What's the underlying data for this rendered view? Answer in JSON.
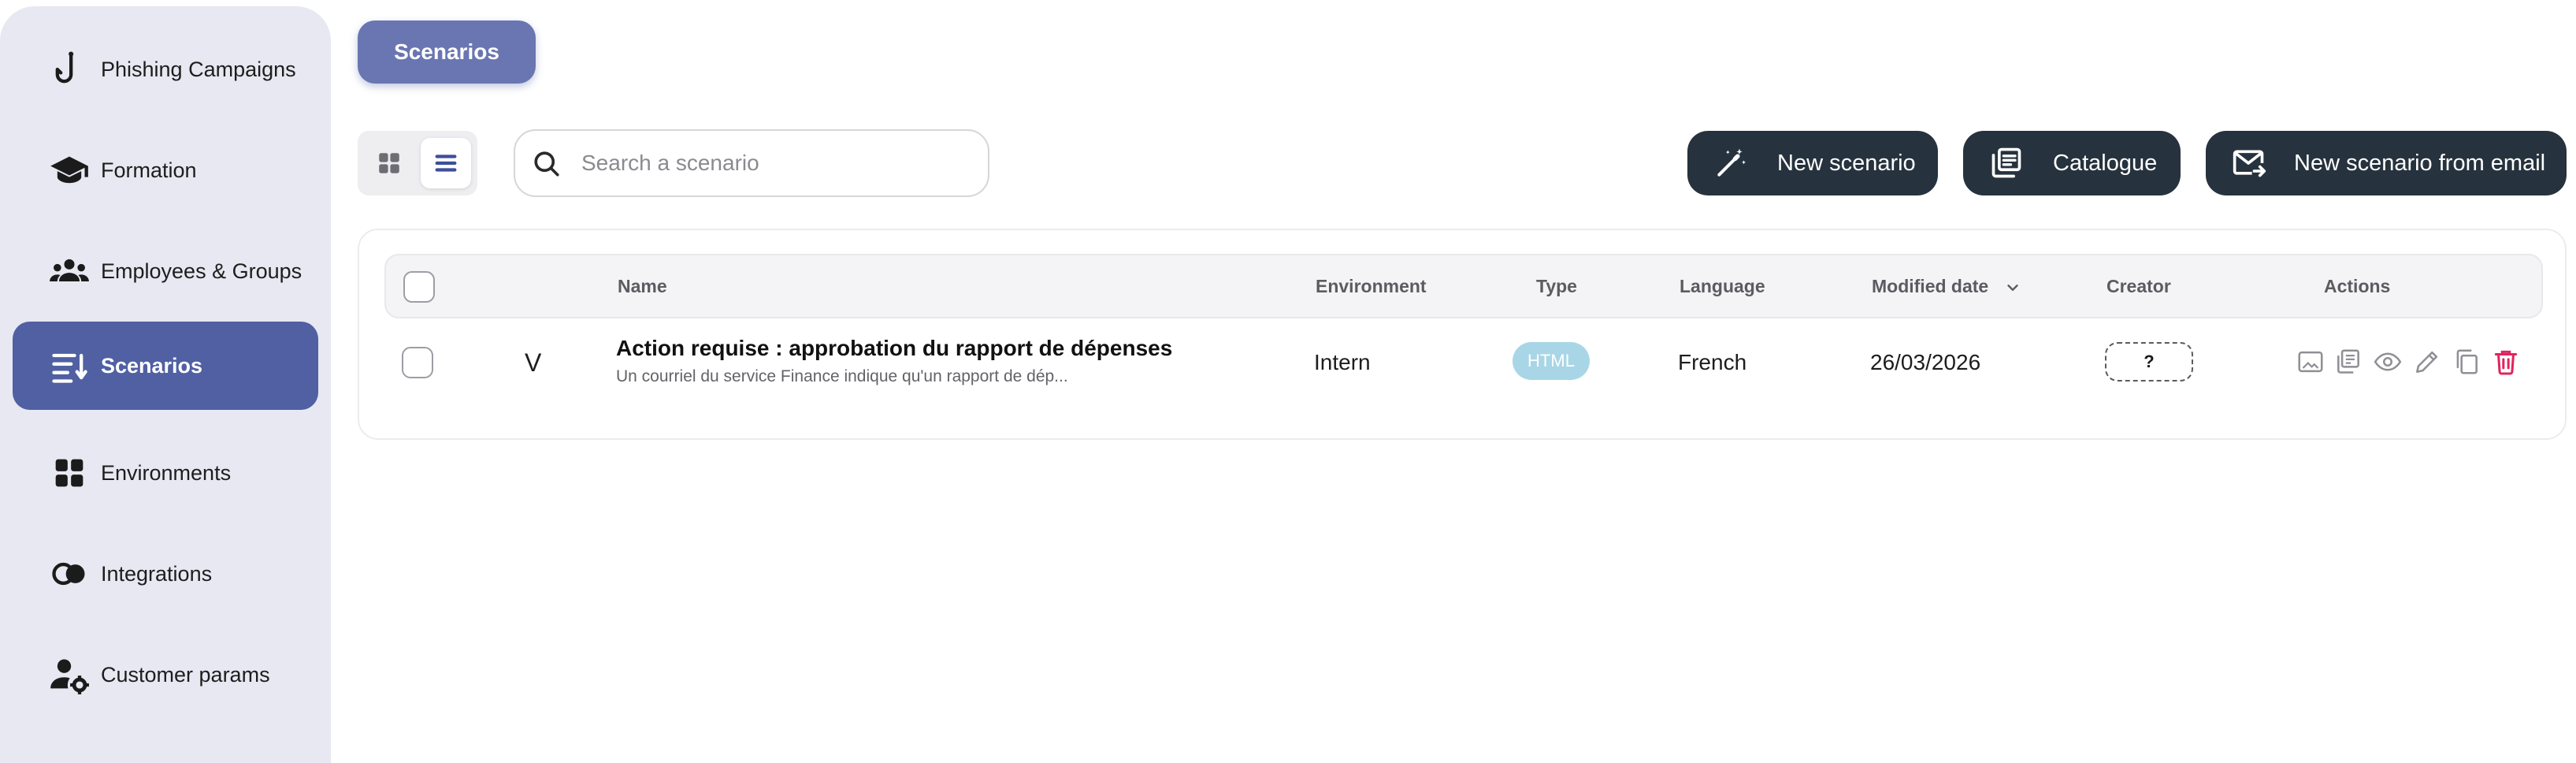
{
  "sidebar": {
    "items": [
      {
        "label": "Phishing Campaigns",
        "icon": "fishing-hook-icon",
        "active": false
      },
      {
        "label": "Formation",
        "icon": "graduation-cap-icon",
        "active": false
      },
      {
        "label": "Employees & Groups",
        "icon": "people-group-icon",
        "active": false
      },
      {
        "label": "Scenarios",
        "icon": "list-icon",
        "active": true
      },
      {
        "label": "Environments",
        "icon": "grid-icon",
        "active": false
      },
      {
        "label": "Integrations",
        "icon": "integrations-icon",
        "active": false
      },
      {
        "label": "Customer params",
        "icon": "user-settings-icon",
        "active": false
      }
    ]
  },
  "header": {
    "tab_label": "Scenarios"
  },
  "toolbar": {
    "search_placeholder": "Search a scenario",
    "search_value": "",
    "view_mode": "list",
    "new_scenario_label": "New scenario",
    "catalogue_label": "Catalogue",
    "new_from_email_label": "New scenario from email"
  },
  "table": {
    "columns": {
      "name": "Name",
      "environment": "Environment",
      "type": "Type",
      "language": "Language",
      "modified_date": "Modified date",
      "creator": "Creator",
      "actions": "Actions"
    },
    "sort_column": "Modified date",
    "sort_direction": "descending",
    "rows": [
      {
        "marker": "V",
        "title": "Action requise : approbation du rapport de dépenses",
        "description": "Un courriel du service Finance indique qu'un rapport de dép...",
        "environment": "Intern",
        "type": "HTML",
        "language": "French",
        "modified_date": "26/03/2026",
        "creator": "?"
      }
    ]
  },
  "colors": {
    "sidebar_bg": "#e7e8f1",
    "active_nav": "#5060a2",
    "tab_chip": "#6a76b1",
    "dark_button": "#26323d",
    "html_badge": "#a8d6e6",
    "delete": "#e0245e"
  }
}
